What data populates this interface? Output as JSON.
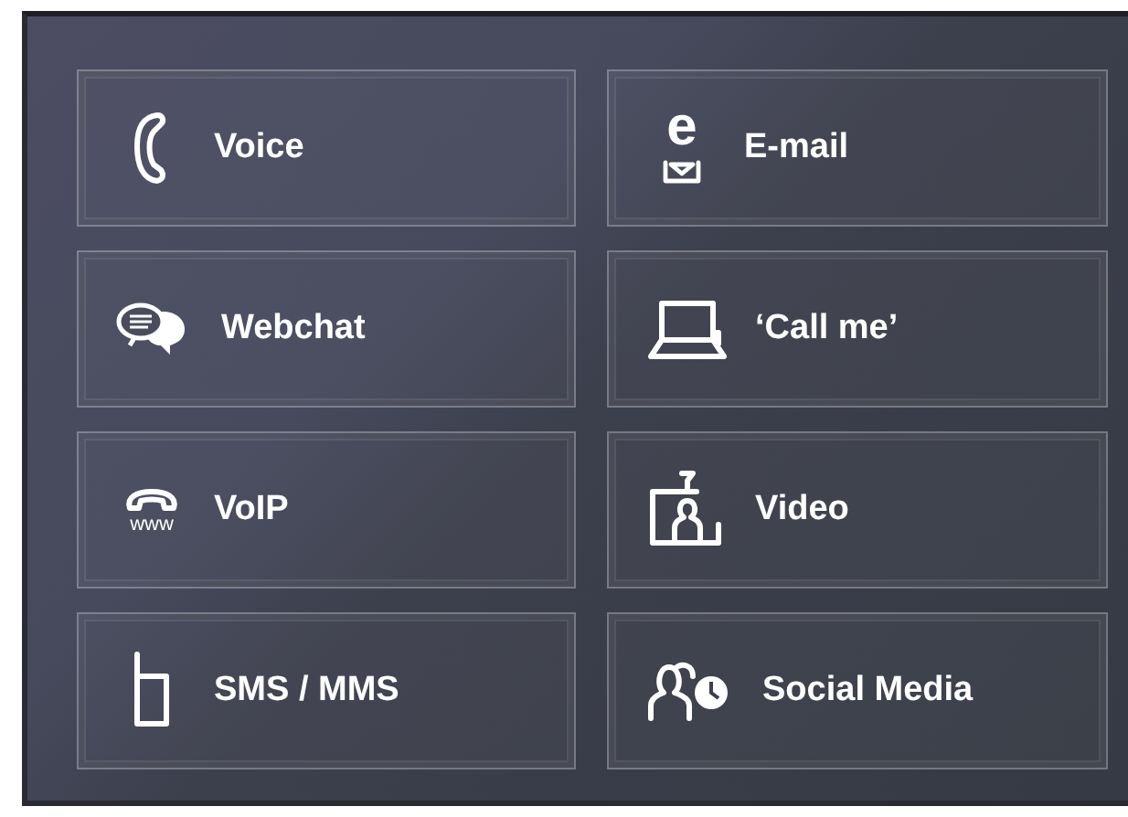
{
  "channels": [
    {
      "label": "Voice",
      "kind": "phone"
    },
    {
      "label": "E-mail",
      "kind": "email",
      "icon_text": "e"
    },
    {
      "label": "Webchat",
      "kind": "chat"
    },
    {
      "label": "‘Call me’",
      "kind": "laptop"
    },
    {
      "label": "VoIP",
      "kind": "voip",
      "icon_text": "www"
    },
    {
      "label": "Video",
      "kind": "video"
    },
    {
      "label": "SMS / MMS",
      "kind": "mobile"
    },
    {
      "label": "Social Media",
      "kind": "social"
    }
  ]
}
